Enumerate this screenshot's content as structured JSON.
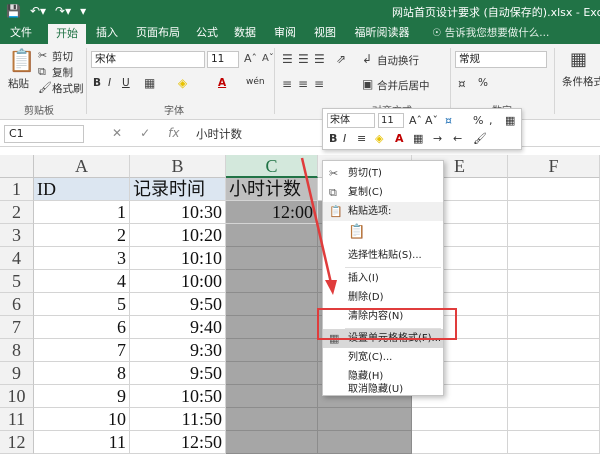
{
  "titlebar": {
    "save_icon": "save-icon",
    "undo_icon": "undo-icon",
    "redo_icon": "redo-icon",
    "title": "网站首页设计要求 (自动保存的).xlsx - Excel(产品激"
  },
  "tabs": [
    {
      "label": "文件"
    },
    {
      "label": "开始"
    },
    {
      "label": "插入"
    },
    {
      "label": "页面布局"
    },
    {
      "label": "公式"
    },
    {
      "label": "数据"
    },
    {
      "label": "审阅"
    },
    {
      "label": "视图"
    },
    {
      "label": "福昕阅读器"
    }
  ],
  "tell_me": "告诉我您想要做什么...",
  "ribbon": {
    "paste": "粘贴",
    "cut": "剪切",
    "copy": "复制",
    "format_painter": "格式刷",
    "clipboard": "剪贴板",
    "font_name": "宋体",
    "font_size": "11",
    "bold": "B",
    "italic": "I",
    "underline": "U",
    "font_color": "A",
    "phonetic": "wén",
    "font_group": "字体",
    "wrap_text": "自动换行",
    "merge_center": "合并后居中",
    "alignment_group": "对齐方式",
    "number_format": "常规",
    "number_group": "数字",
    "conditional_format": "条件格式"
  },
  "formula_bar": {
    "name_box": "C1",
    "formula": "小时计数"
  },
  "columns": [
    "A",
    "B",
    "C",
    "D",
    "E",
    "F"
  ],
  "rows": [
    {
      "n": "1",
      "a": "ID",
      "b": "记录时间",
      "c": "小时计数"
    },
    {
      "n": "2",
      "a": "1",
      "b": "10:30",
      "c": "12:00"
    },
    {
      "n": "3",
      "a": "2",
      "b": "10:20",
      "c": ""
    },
    {
      "n": "4",
      "a": "3",
      "b": "10:10",
      "c": ""
    },
    {
      "n": "5",
      "a": "4",
      "b": "10:00",
      "c": ""
    },
    {
      "n": "6",
      "a": "5",
      "b": "9:50",
      "c": ""
    },
    {
      "n": "7",
      "a": "6",
      "b": "9:40",
      "c": ""
    },
    {
      "n": "8",
      "a": "7",
      "b": "9:30",
      "c": ""
    },
    {
      "n": "9",
      "a": "8",
      "b": "9:50",
      "c": ""
    },
    {
      "n": "10",
      "a": "9",
      "b": "10:50",
      "c": ""
    },
    {
      "n": "11",
      "a": "10",
      "b": "11:50",
      "c": ""
    },
    {
      "n": "12",
      "a": "11",
      "b": "12:50",
      "c": ""
    }
  ],
  "mini_toolbar": {
    "font_name": "宋体",
    "font_size": "11",
    "bold": "B",
    "italic": "I",
    "percent": "%",
    "comma": ","
  },
  "context_menu": {
    "cut": "剪切(T)",
    "copy": "复制(C)",
    "paste_options": "粘贴选项:",
    "paste_special": "选择性粘贴(S)...",
    "insert": "插入(I)",
    "delete": "删除(D)",
    "clear": "清除内容(N)",
    "format_cells": "设置单元格格式(F)...",
    "column_width": "列宽(C)...",
    "hide": "隐藏(H)",
    "unhide": "取消隐藏(U)"
  },
  "colors": {
    "excel_green": "#217346",
    "header_fill": "#dce6f1",
    "selection_grey": "#a6a6a6",
    "annotation_red": "#e03c3c"
  }
}
